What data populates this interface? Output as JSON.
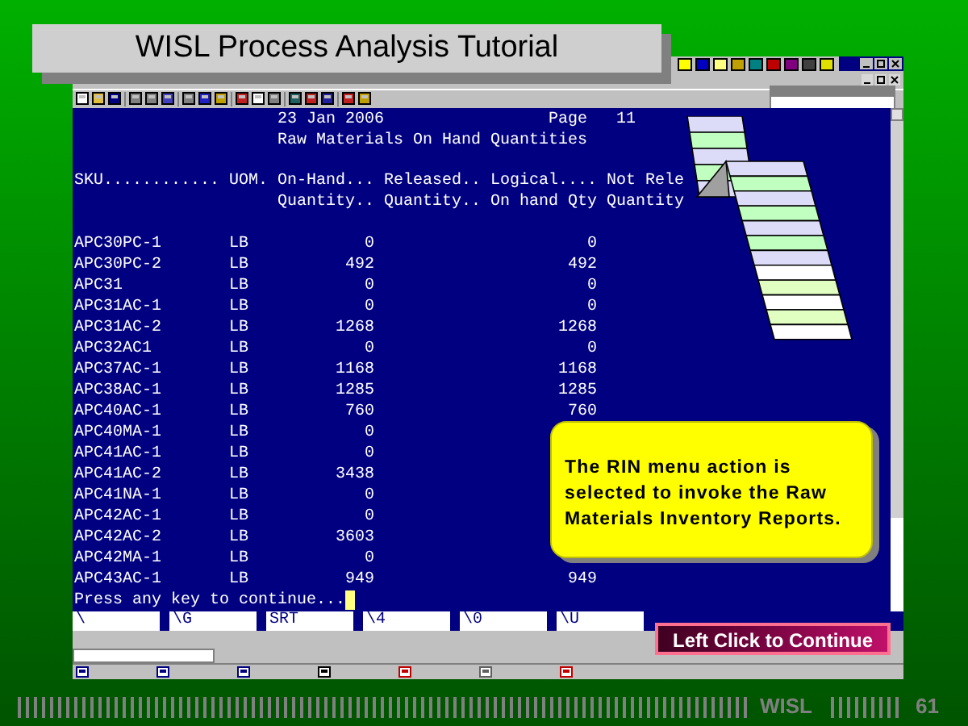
{
  "slide": {
    "title": "WISL Process Analysis Tutorial",
    "footer_label": "WISL",
    "page_number": "61"
  },
  "report": {
    "date": "23 Jan 2006",
    "page": "Page   11",
    "title": "Raw Materials On Hand Quantities",
    "columns": [
      {
        "line1": "SKU............"
      },
      {
        "line1": "UOM."
      },
      {
        "line1": "On-Hand...",
        "line2": "Quantity.."
      },
      {
        "line1": "Released..",
        "line2": "Quantity.."
      },
      {
        "line1": "Logical....",
        "line2": "On hand Qty"
      },
      {
        "line1": "Not Rele",
        "line2": "Quantity"
      }
    ],
    "rows": [
      {
        "sku": "APC30PC-1",
        "uom": "LB",
        "on_hand": "0",
        "logical": "0"
      },
      {
        "sku": "APC30PC-2",
        "uom": "LB",
        "on_hand": "492",
        "logical": "492"
      },
      {
        "sku": "APC31",
        "uom": "LB",
        "on_hand": "0",
        "logical": "0"
      },
      {
        "sku": "APC31AC-1",
        "uom": "LB",
        "on_hand": "0",
        "logical": "0"
      },
      {
        "sku": "APC31AC-2",
        "uom": "LB",
        "on_hand": "1268",
        "logical": "1268"
      },
      {
        "sku": "APC32AC1",
        "uom": "LB",
        "on_hand": "0",
        "logical": "0"
      },
      {
        "sku": "APC37AC-1",
        "uom": "LB",
        "on_hand": "1168",
        "logical": "1168"
      },
      {
        "sku": "APC38AC-1",
        "uom": "LB",
        "on_hand": "1285",
        "logical": "1285"
      },
      {
        "sku": "APC40AC-1",
        "uom": "LB",
        "on_hand": "760",
        "logical": "760"
      },
      {
        "sku": "APC40MA-1",
        "uom": "LB",
        "on_hand": "0"
      },
      {
        "sku": "APC41AC-1",
        "uom": "LB",
        "on_hand": "0"
      },
      {
        "sku": "APC41AC-2",
        "uom": "LB",
        "on_hand": "3438"
      },
      {
        "sku": "APC41NA-1",
        "uom": "LB",
        "on_hand": "0"
      },
      {
        "sku": "APC42AC-1",
        "uom": "LB",
        "on_hand": "0"
      },
      {
        "sku": "APC42AC-2",
        "uom": "LB",
        "on_hand": "3603"
      },
      {
        "sku": "APC42MA-1",
        "uom": "LB",
        "on_hand": "0"
      },
      {
        "sku": "APC43AC-1",
        "uom": "LB",
        "on_hand": "949",
        "logical": "949"
      }
    ],
    "prompt": "Press any key to continue..."
  },
  "function_keys": [
    "\\",
    "\\G",
    "SRT",
    "\\4",
    "\\0",
    "\\U"
  ],
  "callout": {
    "text": "The RIN menu action is selected to invoke the Raw Materials Inventory Reports."
  },
  "continue_button": {
    "label": "Left Click to Continue"
  }
}
